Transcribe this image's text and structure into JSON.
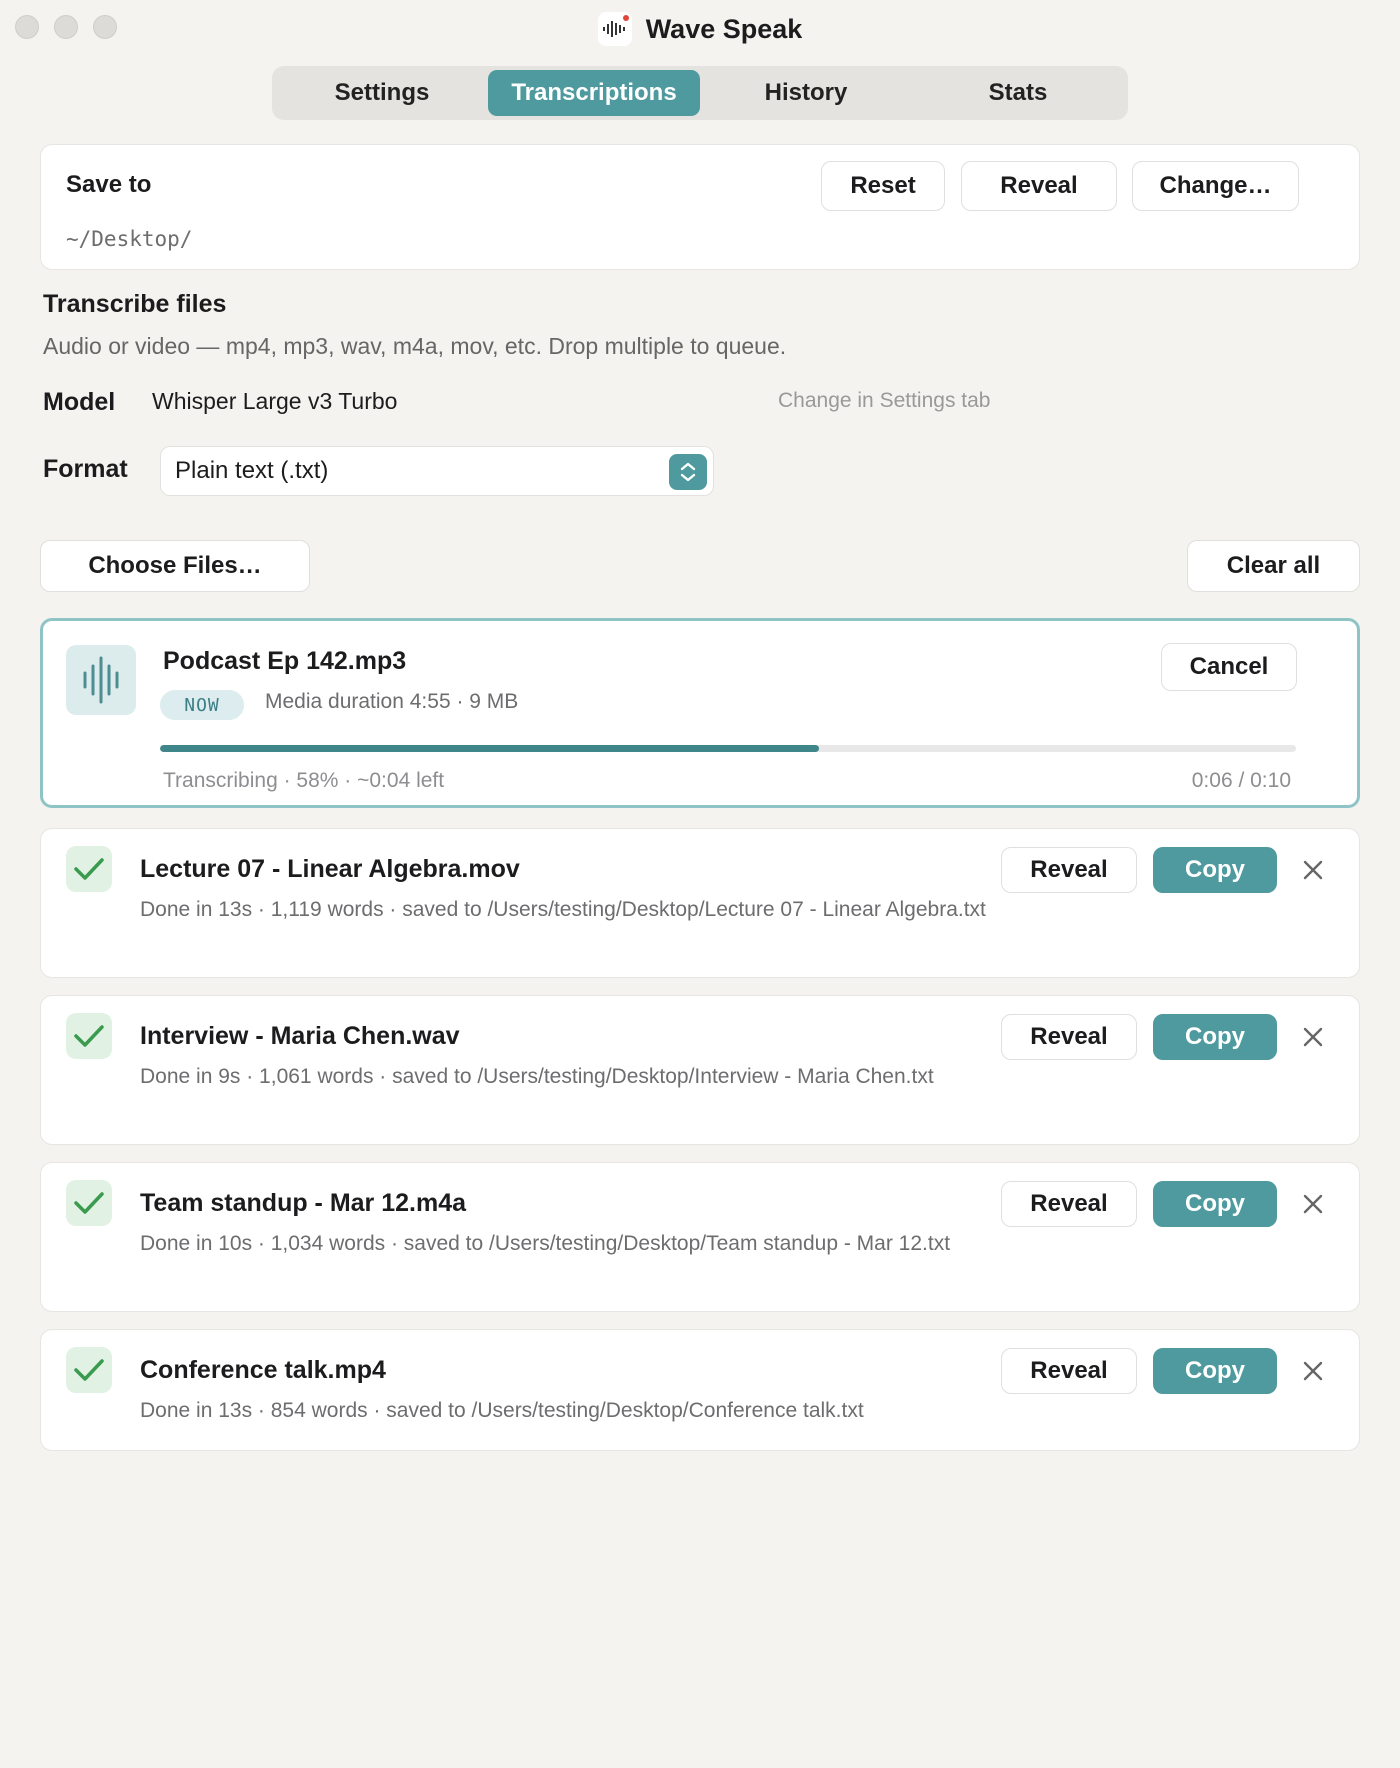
{
  "window": {
    "title": "Wave Speak"
  },
  "tabs": [
    {
      "label": "Settings",
      "active": false
    },
    {
      "label": "Transcriptions",
      "active": true
    },
    {
      "label": "History",
      "active": false
    },
    {
      "label": "Stats",
      "active": false
    }
  ],
  "save_to": {
    "label": "Save to",
    "path": "~/Desktop/",
    "reset_label": "Reset",
    "reveal_label": "Reveal",
    "change_label": "Change…"
  },
  "transcribe": {
    "title": "Transcribe files",
    "description": "Audio or video — mp4, mp3, wav, m4a, mov, etc. Drop multiple to queue.",
    "model_label": "Model",
    "model_value": "Whisper Large v3 Turbo",
    "model_hint": "Change in Settings tab",
    "format_label": "Format",
    "format_value": "Plain text (.txt)",
    "choose_label": "Choose Files…",
    "clear_label": "Clear all"
  },
  "active_job": {
    "name": "Podcast Ep 142.mp3",
    "badge": "NOW",
    "meta": "Media duration 4:55 · 9 MB",
    "cancel_label": "Cancel",
    "progress": 0.58,
    "status": "Transcribing · 58% · ~0:04 left",
    "elapsed": "0:06 / 0:10"
  },
  "done_jobs": [
    {
      "name": "Lecture 07 - Linear Algebra.mov",
      "meta": "Done in 13s · 1,119 words · saved to /Users/testing/Desktop/Lecture 07 - Linear Algebra.txt",
      "reveal_label": "Reveal",
      "copy_label": "Copy"
    },
    {
      "name": "Interview - Maria Chen.wav",
      "meta": "Done in 9s · 1,061 words · saved to /Users/testing/Desktop/Interview - Maria Chen.txt",
      "reveal_label": "Reveal",
      "copy_label": "Copy"
    },
    {
      "name": "Team standup - Mar 12.m4a",
      "meta": "Done in 10s · 1,034 words · saved to /Users/testing/Desktop/Team standup - Mar 12.txt",
      "reveal_label": "Reveal",
      "copy_label": "Copy"
    },
    {
      "name": "Conference talk.mp4",
      "meta": "Done in 13s · 854 words · saved to /Users/testing/Desktop/Conference talk.txt",
      "reveal_label": "Reveal",
      "copy_label": "Copy"
    }
  ],
  "colors": {
    "accent": "#4e9a9e",
    "success": "#3a9a4e",
    "background": "#f4f3f0"
  },
  "icons": {
    "app": "waveform-logo-icon",
    "job": "waveform-icon",
    "done": "checkmark-icon",
    "remove": "close-icon",
    "select": "chevron-updown-icon"
  }
}
